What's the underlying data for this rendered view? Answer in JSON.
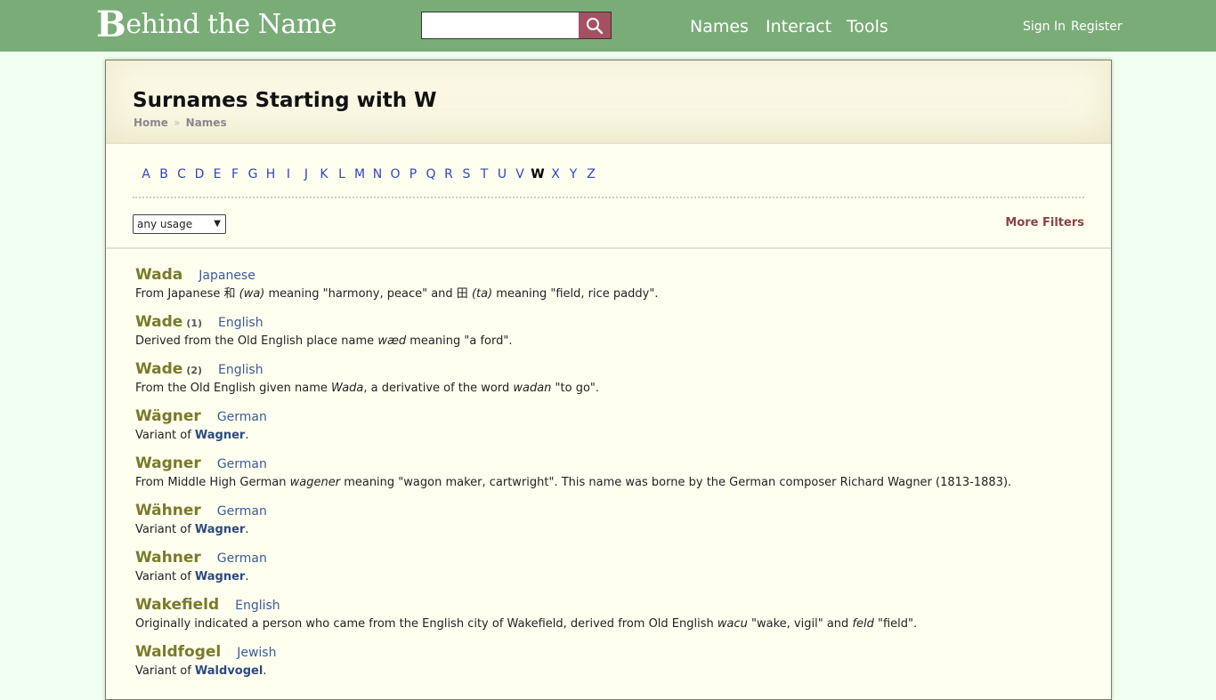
{
  "header": {
    "logo_initial": "B",
    "logo_rest": "ehind the Name",
    "search_placeholder": "",
    "nav": [
      "Names",
      "Interact",
      "Tools"
    ],
    "sign_in": "Sign In",
    "register": "Register"
  },
  "page": {
    "title": "Surnames Starting with W",
    "breadcrumb": [
      "Home",
      "Names"
    ],
    "breadcrumb_sep": "»",
    "letters": [
      "A",
      "B",
      "C",
      "D",
      "E",
      "F",
      "G",
      "H",
      "I",
      "J",
      "K",
      "L",
      "M",
      "N",
      "O",
      "P",
      "Q",
      "R",
      "S",
      "T",
      "U",
      "V",
      "W",
      "X",
      "Y",
      "Z"
    ],
    "active_letter": "W",
    "usage_filter": "any usage",
    "more_filters": "More Filters"
  },
  "entries": [
    {
      "name": "Wada",
      "num": "",
      "usage": "Japanese",
      "desc": [
        {
          "t": "From Japanese 和 "
        },
        {
          "t": "(wa)",
          "i": true
        },
        {
          "t": " meaning \"harmony, peace\" and 田 "
        },
        {
          "t": "(ta)",
          "i": true
        },
        {
          "t": " meaning \"field, rice paddy\"."
        }
      ]
    },
    {
      "name": "Wade",
      "num": "(1)",
      "usage": "English",
      "desc": [
        {
          "t": "Derived from the Old English place name "
        },
        {
          "t": "wæd",
          "i": true
        },
        {
          "t": " meaning \"a ford\"."
        }
      ]
    },
    {
      "name": "Wade",
      "num": "(2)",
      "usage": "English",
      "desc": [
        {
          "t": "From the Old English given name "
        },
        {
          "t": "Wada",
          "i": true
        },
        {
          "t": ", a derivative of the word "
        },
        {
          "t": "wadan",
          "i": true
        },
        {
          "t": " \"to go\"."
        }
      ]
    },
    {
      "name": "Wägner",
      "num": "",
      "usage": "German",
      "desc": [
        {
          "t": "Variant of "
        },
        {
          "t": "Wagner",
          "l": true
        },
        {
          "t": "."
        }
      ]
    },
    {
      "name": "Wagner",
      "num": "",
      "usage": "German",
      "desc": [
        {
          "t": "From Middle High German "
        },
        {
          "t": "wagener",
          "i": true
        },
        {
          "t": " meaning \"wagon maker, cartwright\". This name was borne by the German composer Richard Wagner (1813-1883)."
        }
      ]
    },
    {
      "name": "Wähner",
      "num": "",
      "usage": "German",
      "desc": [
        {
          "t": "Variant of "
        },
        {
          "t": "Wagner",
          "l": true
        },
        {
          "t": "."
        }
      ]
    },
    {
      "name": "Wahner",
      "num": "",
      "usage": "German",
      "desc": [
        {
          "t": "Variant of "
        },
        {
          "t": "Wagner",
          "l": true
        },
        {
          "t": "."
        }
      ]
    },
    {
      "name": "Wakefield",
      "num": "",
      "usage": "English",
      "desc": [
        {
          "t": "Originally indicated a person who came from the English city of Wakefield, derived from Old English "
        },
        {
          "t": "wacu",
          "i": true
        },
        {
          "t": " \"wake, vigil\" and "
        },
        {
          "t": "feld",
          "i": true
        },
        {
          "t": " \"field\"."
        }
      ]
    },
    {
      "name": "Waldfogel",
      "num": "",
      "usage": "Jewish",
      "desc": [
        {
          "t": "Variant of "
        },
        {
          "t": "Waldvogel",
          "l": true
        },
        {
          "t": "."
        }
      ]
    }
  ],
  "icons": {
    "search": "magnifier-icon",
    "dropdown": "dropdown-arrow-icon"
  }
}
